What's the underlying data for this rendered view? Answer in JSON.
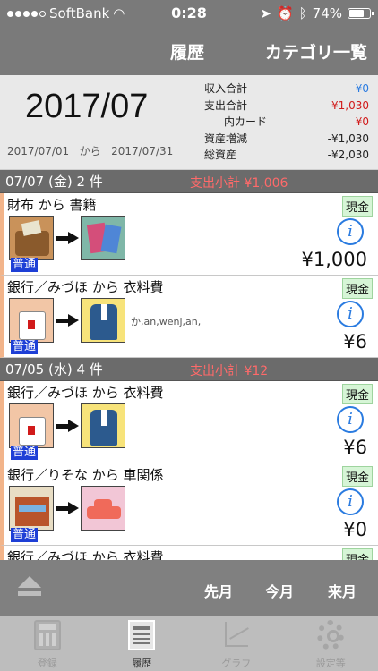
{
  "status": {
    "carrier": "SoftBank",
    "time": "0:28",
    "battery": "74%",
    "battery_level": 0.74
  },
  "nav": {
    "title": "履歴",
    "category_button": "カテゴリ一覧"
  },
  "summary": {
    "month": "2017/07",
    "range_start": "2017/07/01",
    "range_from": "から",
    "range_end": "2017/07/31",
    "rows": [
      {
        "label": "収入合計",
        "value": "¥0",
        "color": "blue"
      },
      {
        "label": "支出合計",
        "value": "¥1,030",
        "color": "red"
      },
      {
        "label": "内カード",
        "value": "¥0",
        "color": "red"
      },
      {
        "label": "資産増減",
        "value": "-¥1,030",
        "color": "black"
      },
      {
        "label": "総資産",
        "value": "-¥2,030",
        "color": "black"
      }
    ]
  },
  "days": [
    {
      "header": "07/07 (金) 2 件",
      "subtotal": "支出小計 ¥1,006",
      "entries": [
        {
          "title": "財布 から 書籍",
          "tag": "現金",
          "from_icon": "wallet-icon",
          "to_icon": "book-icon",
          "memo": "",
          "kind": "普通",
          "amount": "¥1,000"
        },
        {
          "title": "銀行／みづほ から 衣料費",
          "tag": "現金",
          "from_icon": "bank-icon",
          "to_icon": "clothes-icon",
          "memo": "か,an,wenj,an,",
          "kind": "普通",
          "amount": "¥6"
        }
      ]
    },
    {
      "header": "07/05 (水) 4 件",
      "subtotal": "支出小計 ¥12",
      "entries": [
        {
          "title": "銀行／みづほ から 衣料費",
          "tag": "現金",
          "from_icon": "bank-icon",
          "to_icon": "clothes-icon",
          "memo": "",
          "kind": "普通",
          "amount": "¥6"
        },
        {
          "title": "銀行／りそな から 車関係",
          "tag": "現金",
          "from_icon": "bank-building-icon",
          "to_icon": "car-icon",
          "memo": "",
          "kind": "普通",
          "amount": "¥0"
        },
        {
          "title": "銀行／みづほ から 衣料費",
          "tag": "現金",
          "from_icon": "bank-icon",
          "to_icon": "clothes-icon",
          "memo": "",
          "kind": "",
          "amount": ""
        }
      ]
    }
  ],
  "controls": {
    "prev": "先月",
    "current": "今月",
    "next": "来月"
  },
  "tabs": [
    {
      "label": "登録",
      "icon": "calculator-icon"
    },
    {
      "label": "履歴",
      "icon": "history-icon"
    },
    {
      "label": "グラフ",
      "icon": "graph-icon"
    },
    {
      "label": "設定等",
      "icon": "gear-icon"
    }
  ]
}
